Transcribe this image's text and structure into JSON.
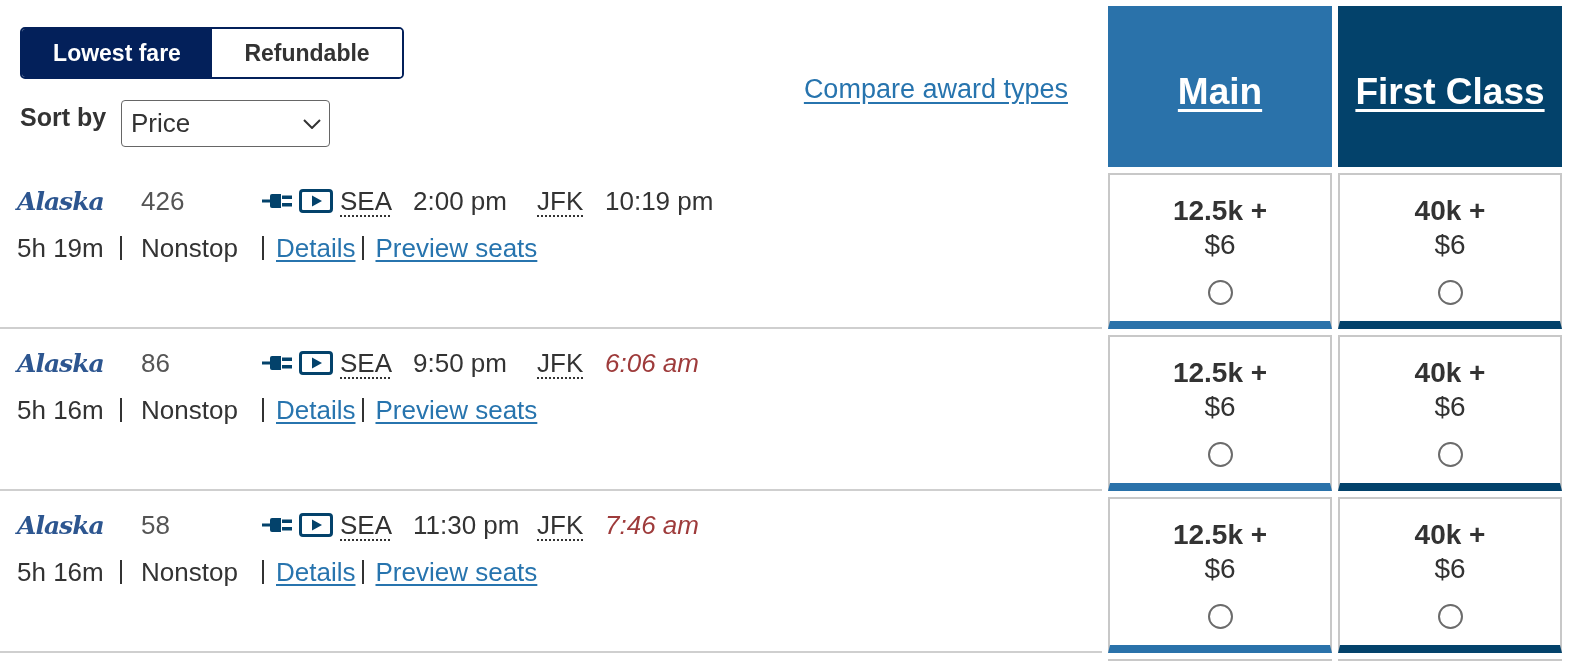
{
  "fare_toggle": [
    {
      "label": "Lowest fare",
      "selected": true
    },
    {
      "label": "Refundable",
      "selected": false
    }
  ],
  "sort": {
    "label": "Sort by",
    "value": "Price"
  },
  "compare_link": "Compare award types",
  "cabins": [
    {
      "name": "Main",
      "color": "#2a72aa"
    },
    {
      "name": "First Class",
      "color": "#03426b"
    }
  ],
  "flights": [
    {
      "airline": "Alaska",
      "number": "426",
      "origin": "SEA",
      "departure": "2:00 pm",
      "destination": "JFK",
      "arrival": "10:19 pm",
      "arrival_next_day": false,
      "duration": "5h 19m",
      "stops": "Nonstop",
      "details_link": "Details",
      "seats_link": "Preview seats",
      "fares": [
        {
          "miles": "12.5k +",
          "price": "$6",
          "selected": false
        },
        {
          "miles": "40k +",
          "price": "$6",
          "selected": false
        }
      ]
    },
    {
      "airline": "Alaska",
      "number": "86",
      "origin": "SEA",
      "departure": "9:50 pm",
      "destination": "JFK",
      "arrival": "6:06 am",
      "arrival_next_day": true,
      "duration": "5h 16m",
      "stops": "Nonstop",
      "details_link": "Details",
      "seats_link": "Preview seats",
      "fares": [
        {
          "miles": "12.5k +",
          "price": "$6",
          "selected": false
        },
        {
          "miles": "40k +",
          "price": "$6",
          "selected": false
        }
      ]
    },
    {
      "airline": "Alaska",
      "number": "58",
      "origin": "SEA",
      "departure": "11:30 pm",
      "destination": "JFK",
      "arrival": "7:46 am",
      "arrival_next_day": true,
      "duration": "5h 16m",
      "stops": "Nonstop",
      "details_link": "Details",
      "seats_link": "Preview seats",
      "fares": [
        {
          "miles": "12.5k +",
          "price": "$6",
          "selected": false
        },
        {
          "miles": "40k +",
          "price": "$6",
          "selected": false
        }
      ]
    }
  ]
}
